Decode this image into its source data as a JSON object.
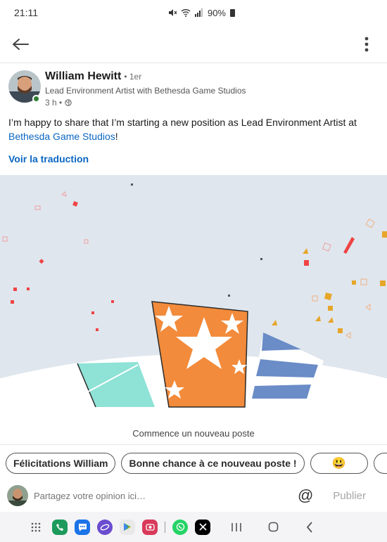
{
  "status_bar": {
    "time": "21:11",
    "battery": "90%"
  },
  "header": {
    "back_icon": "back-arrow-icon",
    "menu_icon": "more-vert-icon"
  },
  "post": {
    "author_name": "William Hewitt",
    "connection_degree": "• 1er",
    "headline": "Lead Environment Artist with Bethesda Game Studios",
    "time_ago": "3 h •",
    "visibility_icon": "globe-icon",
    "text_before": "I’m happy to share that I’m starting a new position as Lead Environment Artist at ",
    "company_link": "Bethesda Game Studios",
    "text_after": "!",
    "translate_label": "Voir la traduction",
    "media_caption": "Commence un nouveau poste"
  },
  "suggestions": [
    "Félicitations William",
    "Bonne chance à ce nouveau poste !",
    "😃"
  ],
  "composer": {
    "placeholder": "Partagez votre opinion ici…",
    "mention_label": "@",
    "publish_label": "Publier"
  },
  "dock": {
    "apps": [
      {
        "name": "phone-app-icon",
        "color": "#1c9a5c"
      },
      {
        "name": "messages-app-icon",
        "color": "#1a73e8"
      },
      {
        "name": "internet-app-icon",
        "color": "#6a4ccf"
      },
      {
        "name": "play-store-app-icon",
        "color": "#e9e9e9"
      },
      {
        "name": "camera-app-icon",
        "color": "#d93a5a"
      },
      {
        "name": "whatsapp-app-icon",
        "color": "#25d366"
      },
      {
        "name": "x-app-icon",
        "color": "#000000"
      }
    ]
  }
}
